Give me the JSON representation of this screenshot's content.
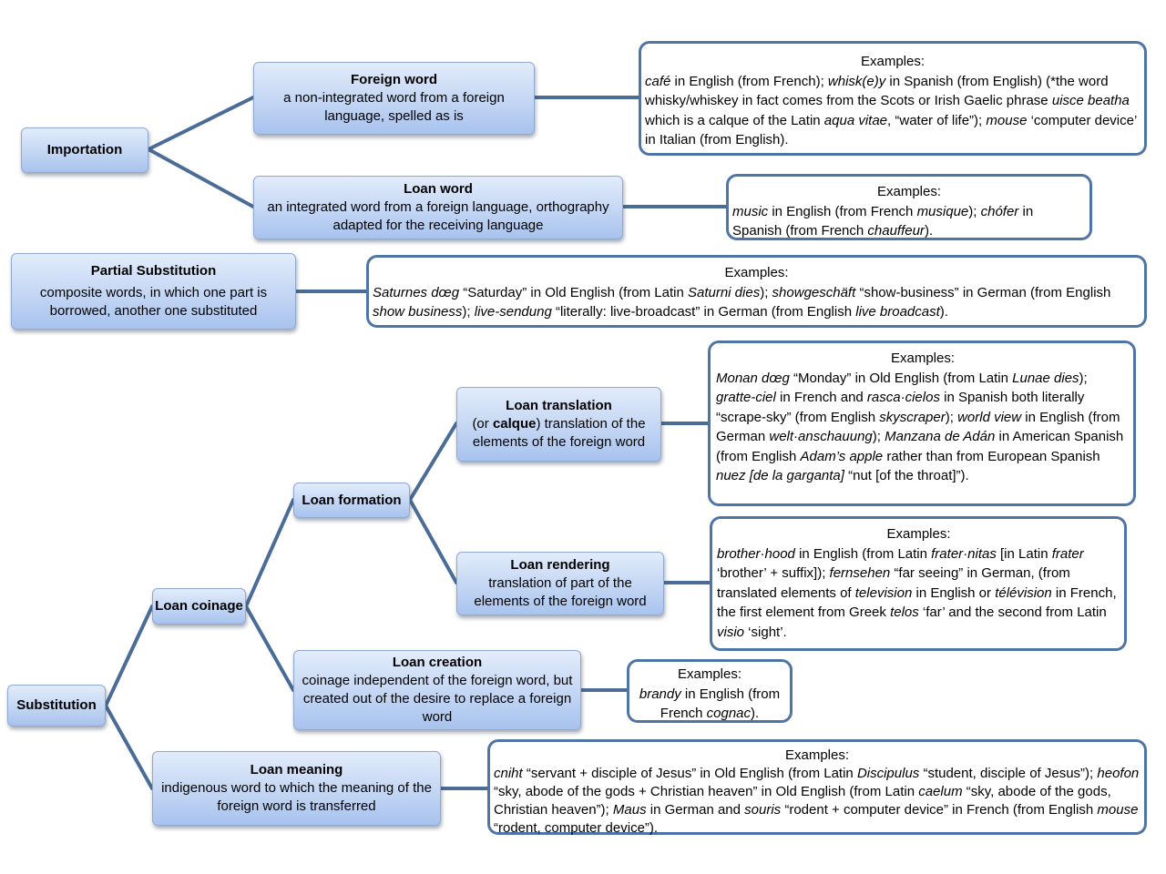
{
  "diagram": {
    "importation": {
      "label": "Importation",
      "foreign_word": {
        "title": "Foreign word",
        "desc": "a non-integrated word from a foreign language, spelled as is",
        "examples_heading": "Examples:",
        "examples": [
          {
            "t": "café",
            "i": true
          },
          {
            "t": " in English (from French); "
          },
          {
            "t": "whisk(e)y",
            "i": true
          },
          {
            "t": " in Spanish (from English) (*the word whisky/whiskey in fact comes from the Scots or Irish Gaelic phrase "
          },
          {
            "t": "uisce beatha",
            "i": true
          },
          {
            "t": " which is a calque of the Latin "
          },
          {
            "t": "aqua vitae",
            "i": true
          },
          {
            "t": ", “water of life”); "
          },
          {
            "t": "mouse",
            "i": true
          },
          {
            "t": " ‘computer device’ in Italian (from English)."
          }
        ]
      },
      "loan_word": {
        "title": "Loan word",
        "desc": "an integrated word from a foreign language, orthography adapted for the receiving language",
        "examples_heading": "Examples:",
        "examples": [
          {
            "t": "music",
            "i": true
          },
          {
            "t": " in English (from French "
          },
          {
            "t": "musique",
            "i": true
          },
          {
            "t": "); "
          },
          {
            "t": "chófer",
            "i": true
          },
          {
            "t": " in Spanish (from French "
          },
          {
            "t": "chauffeur",
            "i": true
          },
          {
            "t": ")."
          }
        ]
      }
    },
    "partial_substitution": {
      "title": "Partial Substitution",
      "desc": "composite words, in which one part is borrowed, another one substituted",
      "examples_heading": "Examples:",
      "examples": [
        {
          "t": "Saturnes dœg",
          "i": true
        },
        {
          "t": " “Saturday” in Old English (from  Latin "
        },
        {
          "t": "Saturni dies",
          "i": true
        },
        {
          "t": "); "
        },
        {
          "t": "showgeschäft",
          "i": true
        },
        {
          "t": " “show-business” in German (from English "
        },
        {
          "t": "show business",
          "i": true
        },
        {
          "t": "); "
        },
        {
          "t": "live-sendung",
          "i": true
        },
        {
          "t": " “literally: live-broadcast” in German (from English "
        },
        {
          "t": "live broadcast",
          "i": true
        },
        {
          "t": ")."
        }
      ]
    },
    "substitution": {
      "label": "Substitution",
      "loan_coinage": {
        "label": "Loan coinage",
        "loan_formation": {
          "label": "Loan formation",
          "loan_translation": {
            "title": "Loan translation",
            "desc_pre": "(or ",
            "desc_bold": "calque",
            "desc_post": ") translation of the elements of the foreign word",
            "examples_heading": "Examples:",
            "examples": [
              {
                "t": "Monan dœg",
                "i": true
              },
              {
                "t": " “Monday” in Old English (from Latin "
              },
              {
                "t": "Lunae dies",
                "i": true
              },
              {
                "t": "); "
              },
              {
                "t": "gratte-ciel",
                "i": true
              },
              {
                "t": " in French and "
              },
              {
                "t": "rasca·cielos",
                "i": true
              },
              {
                "t": " in Spanish both literally “scrape-sky” (from English "
              },
              {
                "t": "skyscraper",
                "i": true
              },
              {
                "t": "); "
              },
              {
                "t": "world view",
                "i": true
              },
              {
                "t": " in English (from German "
              },
              {
                "t": "welt·anschauung",
                "i": true
              },
              {
                "t": "); "
              },
              {
                "t": "Manzana de Adán",
                "i": true
              },
              {
                "t": " in American Spanish (from English "
              },
              {
                "t": "Adam’s apple",
                "i": true
              },
              {
                "t": " rather than from European Spanish "
              },
              {
                "t": "nuez [de la garganta]",
                "i": true
              },
              {
                "t": " “nut [of the throat]”)."
              }
            ]
          },
          "loan_rendering": {
            "title": "Loan rendering",
            "desc": "translation of part of the elements of the foreign word",
            "examples_heading": "Examples:",
            "examples": [
              {
                "t": "brother·hood",
                "i": true
              },
              {
                "t": " in English (from Latin "
              },
              {
                "t": "frater·nitas",
                "i": true
              },
              {
                "t": " [in Latin "
              },
              {
                "t": "frater",
                "i": true
              },
              {
                "t": " ‘brother’ + suffix]); "
              },
              {
                "t": "fernsehen",
                "i": true
              },
              {
                "t": " “far seeing” in German, (from translated elements of "
              },
              {
                "t": "television",
                "i": true
              },
              {
                "t": " in English or "
              },
              {
                "t": "télévision",
                "i": true
              },
              {
                "t": " in French, the first element from Greek "
              },
              {
                "t": "telos",
                "i": true
              },
              {
                "t": " ‘far’ and the second from Latin "
              },
              {
                "t": "visio",
                "i": true
              },
              {
                "t": " ‘sight’."
              }
            ]
          }
        },
        "loan_creation": {
          "title": "Loan creation",
          "desc": "coinage independent of the foreign word, but created out of the desire to replace a foreign word",
          "examples_heading": "Examples:",
          "examples": [
            {
              "t": "brandy",
              "i": true
            },
            {
              "t": " in English (from French "
            },
            {
              "t": "cognac",
              "i": true
            },
            {
              "t": ")."
            }
          ]
        }
      },
      "loan_meaning": {
        "title": "Loan meaning",
        "desc": "indigenous word to which the meaning of the foreign word is transferred",
        "examples_heading": "Examples:",
        "examples": [
          {
            "t": "cniht",
            "i": true
          },
          {
            "t": " “servant + disciple of Jesus” in Old English (from Latin "
          },
          {
            "t": "Discipulus",
            "i": true
          },
          {
            "t": " “student, disciple of Jesus”); "
          },
          {
            "t": "heofon",
            "i": true
          },
          {
            "t": " “sky, abode of the gods + Christian heaven” in Old English (from Latin "
          },
          {
            "t": "caelum",
            "i": true
          },
          {
            "t": " “sky, abode of the gods, Christian heaven”); "
          },
          {
            "t": "Maus",
            "i": true
          },
          {
            "t": " in German and "
          },
          {
            "t": "souris",
            "i": true
          },
          {
            "t": " “rodent + computer device” in French (from English "
          },
          {
            "t": "mouse",
            "i": true
          },
          {
            "t": " “rodent, computer device”)."
          }
        ]
      }
    }
  }
}
